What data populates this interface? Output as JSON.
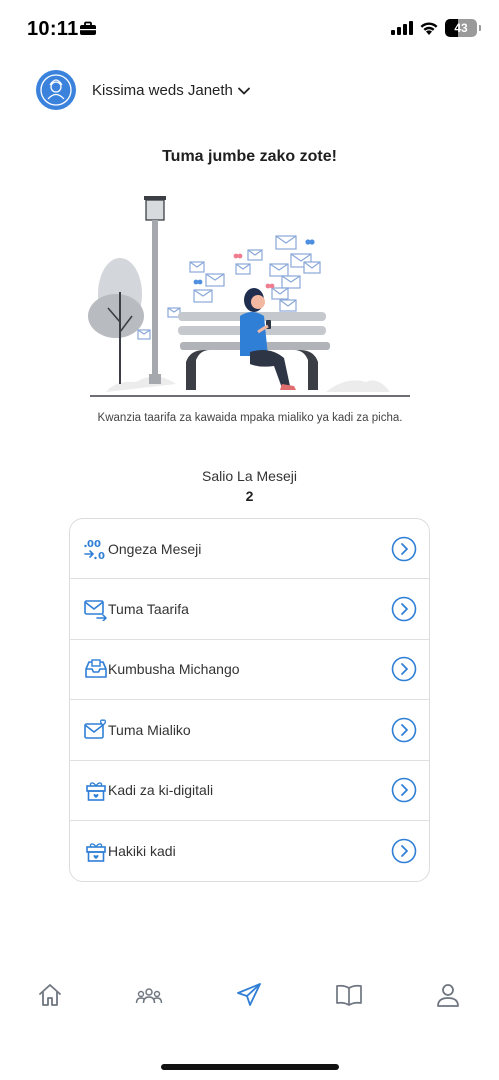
{
  "status": {
    "time": "10:11",
    "battery": "43"
  },
  "header": {
    "event_name": "Kissima weds Janeth"
  },
  "headline": "Tuma jumbe zako zote!",
  "description": "Kwanzia taarifa za kawaida mpaka mialiko ya kadi za picha.",
  "balance": {
    "label": "Salio La Meseji",
    "value": "2"
  },
  "menu": [
    {
      "label": "Ongeza Meseji",
      "icon": "add-messages-icon"
    },
    {
      "label": "Tuma Taarifa",
      "icon": "send-mail-icon"
    },
    {
      "label": "Kumbusha Michango",
      "icon": "reminder-inbox-icon"
    },
    {
      "label": "Tuma Mialiko",
      "icon": "heart-mail-icon"
    },
    {
      "label": "Kadi za ki-digitali",
      "icon": "gift-card-icon"
    },
    {
      "label": "Hakiki kadi",
      "icon": "verify-card-icon"
    }
  ],
  "tabs": [
    {
      "name": "home",
      "icon": "home-icon"
    },
    {
      "name": "guests",
      "icon": "people-icon"
    },
    {
      "name": "send",
      "icon": "send-icon",
      "active": true
    },
    {
      "name": "guide",
      "icon": "book-icon"
    },
    {
      "name": "profile",
      "icon": "person-icon"
    }
  ],
  "colors": {
    "accent": "#2f7fd6",
    "text": "#222222",
    "tab_inactive": "#6f7680"
  }
}
